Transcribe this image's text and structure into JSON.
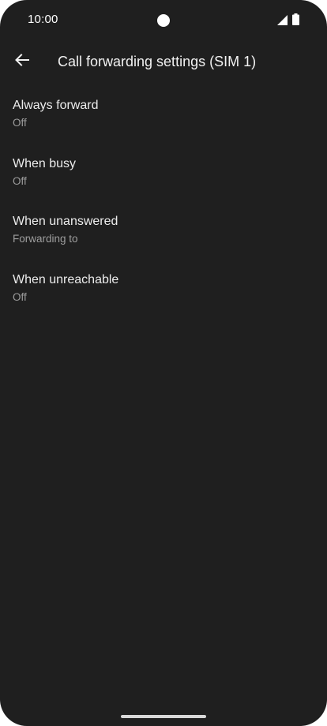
{
  "status_bar": {
    "time": "10:00",
    "icons": [
      "camera-cutout",
      "signal-icon",
      "battery-icon"
    ]
  },
  "app_bar": {
    "back_icon": "arrow-back-icon",
    "title": "Call forwarding settings (SIM 1)"
  },
  "settings": {
    "items": [
      {
        "title": "Always forward",
        "summary": "Off"
      },
      {
        "title": "When busy",
        "summary": "Off"
      },
      {
        "title": "When unanswered",
        "summary": "Forwarding to"
      },
      {
        "title": "When unreachable",
        "summary": "Off"
      }
    ]
  },
  "colors": {
    "background": "#1f1f1f",
    "title_text": "#ececec",
    "summary_text": "#9e9e9e"
  }
}
